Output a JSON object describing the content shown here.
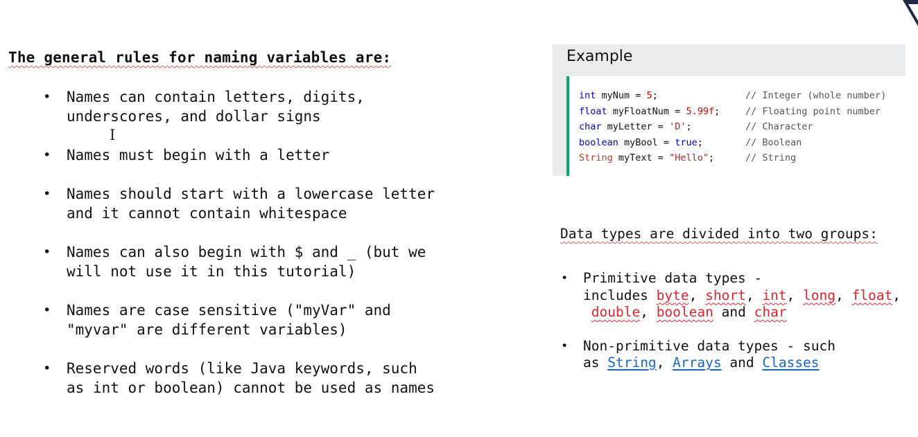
{
  "rules": {
    "heading": "The general rules for naming variables are:",
    "items": [
      {
        "lines": [
          "Names can contain letters, digits,",
          "underscores, and dollar signs"
        ]
      },
      {
        "lines": [
          "Names must begin with a letter"
        ]
      },
      {
        "lines": [
          "Names should start with a lowercase letter",
          "and it cannot contain whitespace"
        ]
      },
      {
        "lines": [
          "Names can also begin with $ and _ (but we",
          "will not use it in this tutorial)"
        ]
      },
      {
        "lines": [
          "Names are case sensitive (\"myVar\" and",
          "\"myvar\" are different variables)"
        ]
      },
      {
        "lines": [
          "Reserved words (like Java keywords, such",
          "as int or boolean) cannot be used as names"
        ]
      }
    ]
  },
  "cursor_glyph": "I",
  "example": {
    "title": "Example",
    "code": [
      {
        "type": "int",
        "name": " myNum = ",
        "value": "5",
        "end": ";",
        "comment": "// Integer (whole number)"
      },
      {
        "type": "float",
        "name": " myFloatNum = ",
        "value": "5.99f",
        "end": ";",
        "comment": "// Floating point number"
      },
      {
        "type": "char",
        "name": " myLetter = ",
        "value": "'D'",
        "end": ";",
        "comment": "// Character"
      },
      {
        "type": "boolean",
        "name": " myBool = ",
        "value": "true",
        "end": ";",
        "comment": "// Boolean"
      },
      {
        "type": "String",
        "name": " myText = ",
        "value": "\"Hello\"",
        "end": ";",
        "comment": "// String"
      }
    ]
  },
  "data_types": {
    "heading": "Data types are divided into two groups:",
    "primitive": {
      "line1": "Primitive data types -",
      "includes": "includes",
      "types": [
        "byte",
        "short",
        "int",
        "long",
        "float",
        "double",
        "boolean",
        "char"
      ],
      "and": "and"
    },
    "non_primitive": {
      "line1": "Non-primitive data types - such",
      "as": "as",
      "links": [
        "String",
        "Arrays",
        "Classes"
      ],
      "and": "and"
    }
  },
  "colors": {
    "code_accent": "#04aa6d",
    "panel_bg": "#e9ebec",
    "type_red": "#e0242e",
    "link_blue": "#1a66c8"
  }
}
